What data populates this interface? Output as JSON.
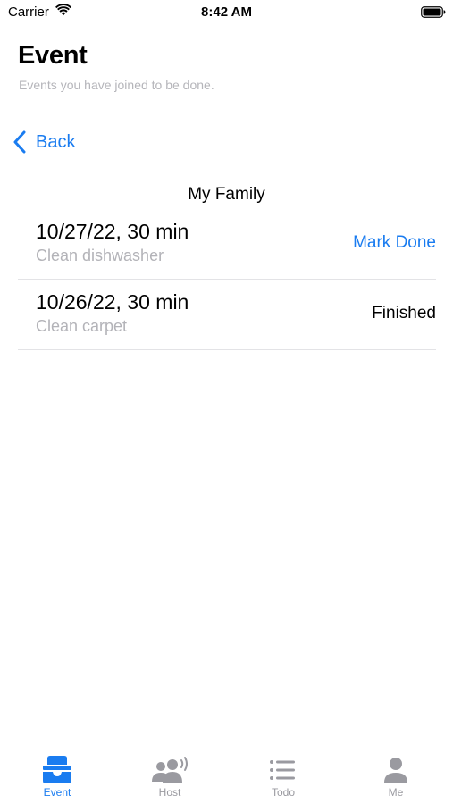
{
  "status_bar": {
    "carrier": "Carrier",
    "time": "8:42 AM",
    "icons": [
      "wifi-icon",
      "battery-icon"
    ]
  },
  "header": {
    "title": "Event",
    "subtitle": "Events you have joined to be done."
  },
  "nav": {
    "back_label": "Back",
    "back_icon": "chevron-left-icon"
  },
  "group": {
    "title": "My Family"
  },
  "events": [
    {
      "when": "10/27/22, 30 min",
      "task": "Clean dishwasher",
      "action": "Mark Done",
      "action_type": "button"
    },
    {
      "when": "10/26/22, 30 min",
      "task": "Clean carpet",
      "action": "Finished",
      "action_type": "status"
    }
  ],
  "tab_bar": {
    "active": "Event",
    "tabs": [
      {
        "label": "Event",
        "icon": "tray-icon"
      },
      {
        "label": "Host",
        "icon": "people-broadcast-icon"
      },
      {
        "label": "Todo",
        "icon": "list-icon"
      },
      {
        "label": "Me",
        "icon": "person-icon"
      }
    ]
  },
  "colors": {
    "accent": "#1a7cf0",
    "secondary_text": "#b3b3b8",
    "inactive_tab": "#9a9aa0",
    "separator": "#e3e3e6"
  }
}
